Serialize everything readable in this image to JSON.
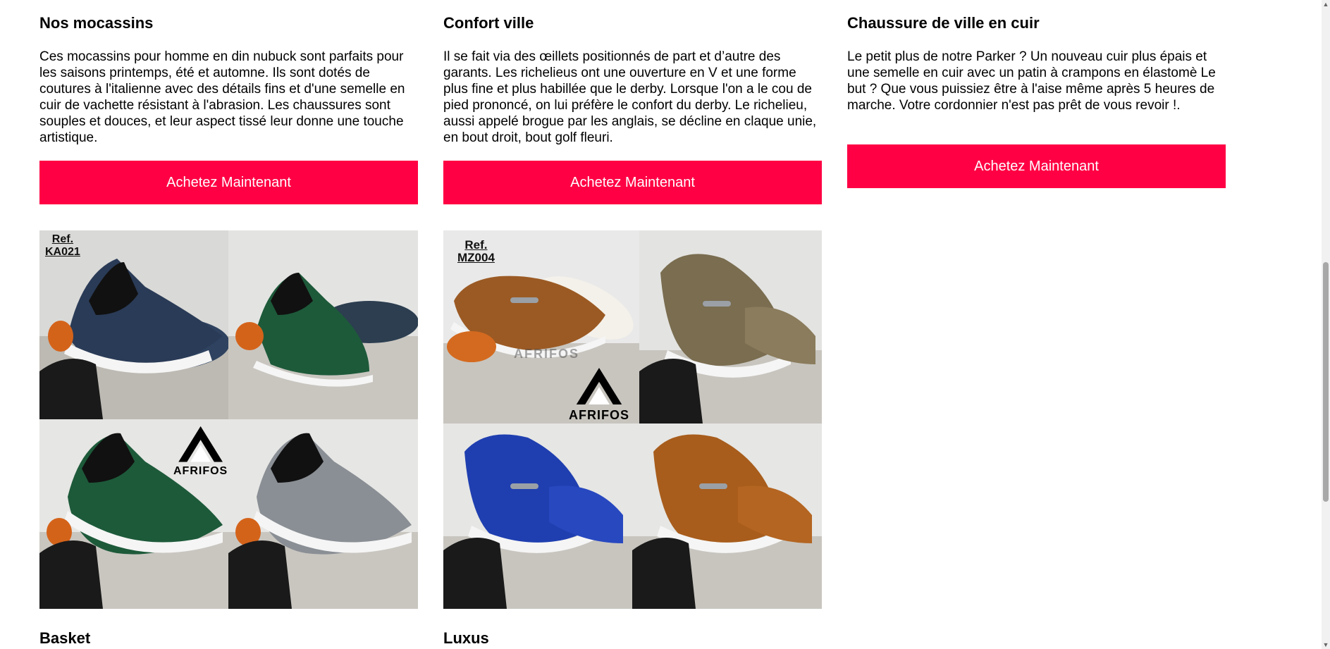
{
  "products": [
    {
      "title": "Nos mocassins",
      "description": "Ces mocassins pour homme en din nubuck sont parfaits pour les saisons printemps, été et automne. Ils sont dotés de coutures à l'italienne avec des détails fins et d'une semelle en cuir de vachette résistant à l'abrasion. Les chaussures sont souples et douces, et leur aspect tissé leur donne une touche artistique.",
      "button": "Achetez Maintenant",
      "ref_label": "Ref.",
      "ref_code": "KA021",
      "logo_text": "AFRIFOS",
      "watermark": "AFRIFOS"
    },
    {
      "title": "Confort ville",
      "description": "Il se fait via des œillets positionnés de part et d’autre des garants. Les richelieus ont une ouverture en V et une forme plus fine et plus habillée que le derby. Lorsque l'on a le cou de pied prononcé, on lui préfère le confort du derby. Le richelieu, aussi appelé brogue par les anglais, se décline en claque unie, en bout droit, bout golf fleuri.",
      "button": "Achetez Maintenant",
      "ref_label": "Ref.",
      "ref_code": "MZ004",
      "logo_text": "AFRIFOS",
      "watermark": "AFRIFOS"
    },
    {
      "title": "Chaussure de ville en cuir",
      "description": "Le petit plus de notre Parker ? Un nouveau cuir plus épais et une semelle en cuir avec un patin à crampons en élastomè Le but ? Que vous puissiez être à l'aise même après 5 heures de marche. Votre cordonnier n'est pas prêt de vous revoir !.",
      "button": "Achetez Maintenant"
    }
  ],
  "next_sections": [
    "Basket",
    "Luxus"
  ],
  "colors": {
    "accent": "#ff0044",
    "button_text": "#ffffff"
  }
}
